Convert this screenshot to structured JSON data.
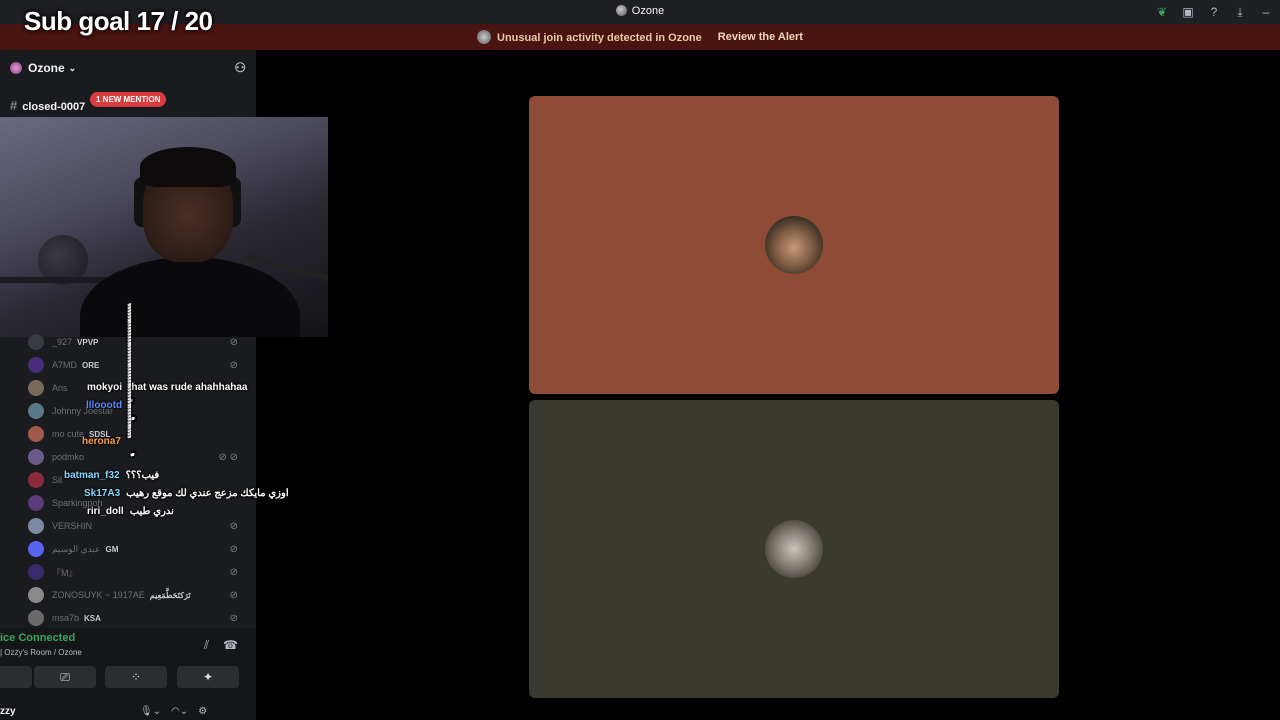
{
  "app": {
    "title": "Ozone",
    "window_icons": [
      "leaf-icon",
      "screen-icon",
      "help-icon",
      "download-icon",
      "minimize-icon"
    ]
  },
  "overlay": {
    "sub_goal": "Sub goal 17 / 20"
  },
  "alert": {
    "message": "Unusual join activity detected in Ozone",
    "action": "Review the Alert"
  },
  "sidebar": {
    "server_name": "Ozone",
    "channel": "closed-0007",
    "mention_badge": "1 NEW MENTION"
  },
  "members": [
    {
      "name": "_927",
      "tag": "VPVP",
      "color": "#3a3a44"
    },
    {
      "name": "A7MD",
      "tag": "ORE",
      "color": "#4a2d7a"
    },
    {
      "name": "Ans",
      "tag": "",
      "color": "#7a6a5a"
    },
    {
      "name": "Johnny Joestar",
      "tag": "",
      "color": "#5a7a8a"
    },
    {
      "name": "mo cute",
      "tag": "SDSL",
      "color": "#a05a4a"
    },
    {
      "name": "podmko",
      "tag": "",
      "color": "#6a5a8a"
    },
    {
      "name": "Sil",
      "tag": "",
      "color": "#8a2a3a"
    },
    {
      "name": "Sparkingpoh",
      "tag": "",
      "color": "#5a3a7a"
    },
    {
      "name": "VERSHIN",
      "tag": "",
      "color": "#7a8aa0"
    },
    {
      "name": "عبدي الوسيم",
      "tag": "GM",
      "color": "#5865f2"
    },
    {
      "name": "『M』",
      "tag": "",
      "color": "#3a2a6a"
    },
    {
      "name": "ZONOSUYK ~ 1917AE",
      "tag": "تَرَكتَحَطَّمَعِيم",
      "color": "#8a8a8a"
    },
    {
      "name": "msa7b",
      "tag": "KSA",
      "color": "#6a6a6a"
    }
  ],
  "chat": [
    {
      "user": "mokyoi",
      "text": "that was rude ahahhahaa",
      "color": "#ffffff"
    },
    {
      "user": "llloootd",
      "text": "ّّّّّّّّّّّّّّّّّّّّّّّّّّّّّّّّّّّّّّّّّّّّّّّّ",
      "color": "#5b8bff"
    },
    {
      "user": "",
      "text": "ّّّّّّّّّّّّّّّّّّّّّّّّّّّّّ",
      "color": "#ffffff"
    },
    {
      "user": "herona7",
      "text": "ّّّّّّّّّّّّّّّّّّّّّّّّّّّّّّّّّّّّّّّّّّّّّّ",
      "color": "#ffa046"
    },
    {
      "user": "",
      "text": "ّّّّّّ",
      "color": "#ffffff"
    },
    {
      "user": "batman_f32",
      "text": "فيب؟؟؟",
      "color": "#8ad6ff"
    },
    {
      "user": "Sk17A3",
      "text": "اوزي مايكك مزعج عندي لك موقع رهيب",
      "color": "#8ad6ff"
    },
    {
      "user": "riri_doll",
      "text": "ندري طيب",
      "color": "#ffffff"
    }
  ],
  "voice": {
    "status": "ice Connected",
    "room": "| Ozzy's Room / Ozone",
    "user": "zzy"
  },
  "colors": {
    "tile1_bg": "#8e4b36",
    "tile2_bg": "#3a3a30",
    "alert_bg": "#4a1410",
    "connected": "#3ba55d"
  }
}
